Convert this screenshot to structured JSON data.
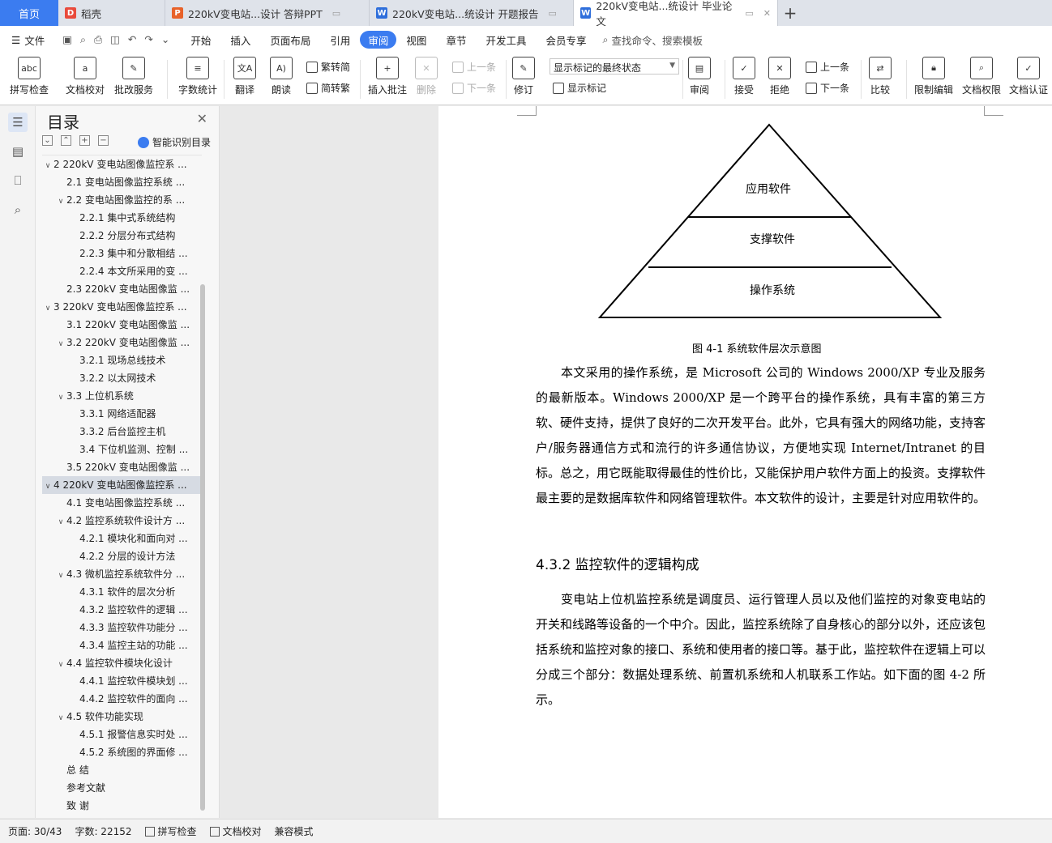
{
  "tabs": {
    "home": "首页",
    "items": [
      {
        "label": "稻壳",
        "icon": "daoke-icon",
        "color": "#e94b3c"
      },
      {
        "label": "220kV变电站...设计 答辩PPT",
        "icon": "ppt-icon",
        "color": "#e8622a"
      },
      {
        "label": "220kV变电站...统设计 开题报告",
        "icon": "word-icon",
        "color": "#2f6fdb"
      },
      {
        "label": "220kV变电站...统设计 毕业论文",
        "icon": "word-icon",
        "color": "#2f6fdb"
      }
    ],
    "add": "+"
  },
  "menu": {
    "file": "文件",
    "items": [
      "开始",
      "插入",
      "页面布局",
      "引用",
      "审阅",
      "视图",
      "章节",
      "开发工具",
      "会员专享"
    ],
    "active": "审阅",
    "search": "查找命令、搜索模板"
  },
  "ribbon": {
    "spell": "拼写检查",
    "proof": "文档校对",
    "batch": "批改服务",
    "wordcount": "字数统计",
    "translate": "翻译",
    "read": "朗读",
    "trad": "繁转简",
    "simp": "简转繁",
    "insert_comment": "插入批注",
    "delete": "删除",
    "prev_comment": "上一条",
    "next_comment": "下一条",
    "revise": "修订",
    "markup_state": "显示标记的最终状态",
    "show_markup": "显示标记",
    "review": "审阅",
    "accept": "接受",
    "reject": "拒绝",
    "prev": "上一条",
    "next": "下一条",
    "compare": "比较",
    "restrict": "限制编辑",
    "permission": "文档权限",
    "certify": "文档认证"
  },
  "toc": {
    "title": "目录",
    "smart": "智能识别目录",
    "items": [
      {
        "text": "2 220kV 变电站图像监控系 ...",
        "level": 1,
        "caret": "v"
      },
      {
        "text": "2.1  变电站图像监控系统 ...",
        "level": 2,
        "caret": ""
      },
      {
        "text": "2.2  变电站图像监控的系 ...",
        "level": 2,
        "caret": "v"
      },
      {
        "text": "2.2.1  集中式系统结构",
        "level": 3,
        "caret": ""
      },
      {
        "text": "2.2.2  分层分布式结构",
        "level": 3,
        "caret": ""
      },
      {
        "text": "2.2.3  集中和分散相结 ...",
        "level": 3,
        "caret": ""
      },
      {
        "text": "2.2.4  本文所采用的变 ...",
        "level": 3,
        "caret": ""
      },
      {
        "text": "2.3 220kV 变电站图像监 ...",
        "level": 2,
        "caret": ""
      },
      {
        "text": "3 220kV 变电站图像监控系 ...",
        "level": 1,
        "caret": "v"
      },
      {
        "text": "3.1 220kV 变电站图像监 ...",
        "level": 2,
        "caret": ""
      },
      {
        "text": "3.2 220kV 变电站图像监 ...",
        "level": 2,
        "caret": "v"
      },
      {
        "text": "3.2.1  现场总线技术",
        "level": 3,
        "caret": ""
      },
      {
        "text": "3.2.2  以太网技术",
        "level": 3,
        "caret": ""
      },
      {
        "text": "3.3  上位机系统",
        "level": 2,
        "caret": "v"
      },
      {
        "text": "3.3.1  网络适配器",
        "level": 3,
        "caret": ""
      },
      {
        "text": "3.3.2  后台监控主机",
        "level": 3,
        "caret": ""
      },
      {
        "text": "3.4  下位机监测、控制 ...",
        "level": 3,
        "caret": ""
      },
      {
        "text": "3.5 220kV 变电站图像监 ...",
        "level": 2,
        "caret": ""
      },
      {
        "text": "4 220kV 变电站图像监控系 ...",
        "level": 1,
        "caret": "v",
        "active": true
      },
      {
        "text": "4.1  变电站图像监控系统 ...",
        "level": 2,
        "caret": ""
      },
      {
        "text": "4.2  监控系统软件设计方 ...",
        "level": 2,
        "caret": "v"
      },
      {
        "text": "4.2.1  模块化和面向对 ...",
        "level": 3,
        "caret": ""
      },
      {
        "text": "4.2.2  分层的设计方法",
        "level": 3,
        "caret": ""
      },
      {
        "text": "4.3  微机监控系统软件分 ...",
        "level": 2,
        "caret": "v"
      },
      {
        "text": "4.3.1  软件的层次分析",
        "level": 3,
        "caret": ""
      },
      {
        "text": "4.3.2  监控软件的逻辑 ...",
        "level": 3,
        "caret": ""
      },
      {
        "text": "4.3.3  监控软件功能分 ...",
        "level": 3,
        "caret": ""
      },
      {
        "text": "4.3.4  监控主站的功能 ...",
        "level": 3,
        "caret": ""
      },
      {
        "text": "4.4  监控软件模块化设计",
        "level": 2,
        "caret": "v"
      },
      {
        "text": "4.4.1  监控软件模块划 ...",
        "level": 3,
        "caret": ""
      },
      {
        "text": "4.4.2  监控软件的面向 ...",
        "level": 3,
        "caret": ""
      },
      {
        "text": "4.5  软件功能实现",
        "level": 2,
        "caret": "v"
      },
      {
        "text": "4.5.1  报警信息实时处 ...",
        "level": 3,
        "caret": ""
      },
      {
        "text": "4.5.2  系统图的界面修 ...",
        "level": 3,
        "caret": ""
      },
      {
        "text": "总    结",
        "level": 0,
        "caret": ""
      },
      {
        "text": "参考文献",
        "level": 0,
        "caret": ""
      },
      {
        "text": "致    谢",
        "level": 0,
        "caret": ""
      }
    ]
  },
  "doc": {
    "pyramid": {
      "top": "应用软件",
      "middle": "支撑软件",
      "bottom": "操作系统"
    },
    "caption": "图 4-1  系统软件层次示意图",
    "para1": "本文采用的操作系统，是 Microsoft 公司的 Windows 2000/XP 专业及服务的最新版本。Windows 2000/XP 是一个跨平台的操作系统，具有丰富的第三方软、硬件支持，提供了良好的二次开发平台。此外，它具有强大的网络功能，支持客户/服务器通信方式和流行的许多通信协议，方便地实现 Internet/Intranet 的目标。总之，用它既能取得最佳的性价比，又能保护用户软件方面上的投资。支撑软件最主要的是数据库软件和网络管理软件。本文软件的设计，主要是针对应用软件的。",
    "heading": "4.3.2  监控软件的逻辑构成",
    "para2": "变电站上位机监控系统是调度员、运行管理人员以及他们监控的对象变电站的开关和线路等设备的一个中介。因此，监控系统除了自身核心的部分以外，还应该包括系统和监控对象的接口、系统和使用者的接口等。基于此，监控软件在逻辑上可以分成三个部分：数据处理系统、前置机系统和人机联系工作站。如下面的图 4-2 所示。"
  },
  "status": {
    "page": "页面: 30/43",
    "words": "字数: 22152",
    "spell": "拼写检查",
    "proof": "文档校对",
    "compat": "兼容模式"
  }
}
